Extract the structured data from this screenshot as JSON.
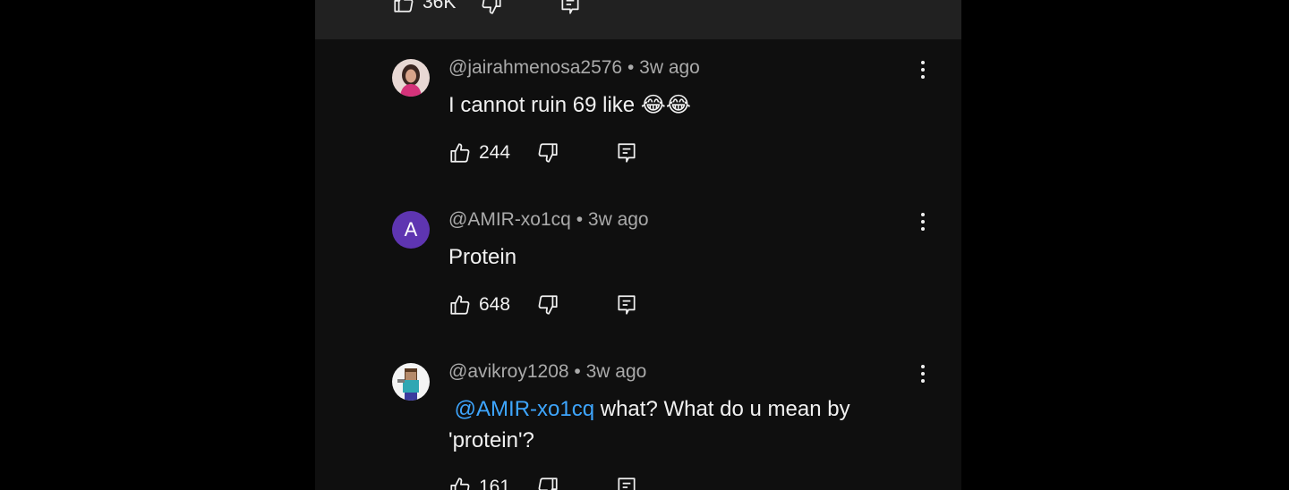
{
  "top": {
    "likes": "36K"
  },
  "comments": [
    {
      "handle": "@jairahmenosa2576",
      "separator": " • ",
      "time": "3w ago",
      "text": "I cannot ruin 69 like 😂😂",
      "likes": "244",
      "avatar_icon": "user-photo-avatar"
    },
    {
      "handle": "@AMIR-xo1cq",
      "separator": " • ",
      "time": "3w ago",
      "text": "Protein",
      "likes": "648",
      "avatar_letter": "A",
      "avatar_color": "#5e35b1"
    },
    {
      "handle": "@avikroy1208",
      "separator": " • ",
      "time": "3w ago",
      "mention": "@AMIR-xo1cq",
      "text": " what? What do u mean by 'protein'?",
      "likes": "161",
      "avatar_icon": "minecraft-avatar"
    }
  ],
  "colors": {
    "panel_bg": "#0f0f0f",
    "top_bar_bg": "#212121",
    "meta_text": "#aaaaaa",
    "mention": "#3ea6ff"
  }
}
